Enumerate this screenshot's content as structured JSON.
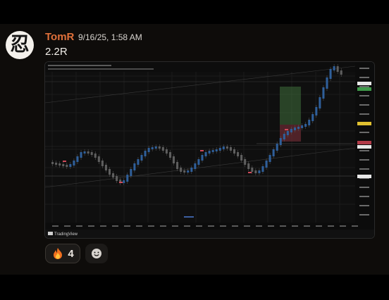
{
  "message": {
    "author": "TomR",
    "timestamp": "9/16/25, 1:58 AM",
    "text": "2.2R",
    "avatar_glyph": "忍",
    "author_color": "#e0703a"
  },
  "attachment": {
    "kind": "tradingview-chart-screenshot",
    "footer_brand": "TradingView",
    "colors": {
      "up_candle": "#2f5f9a",
      "down_candle": "#5e5e5e",
      "profit_zone": "#3f6f3c",
      "loss_zone": "#7a2e38",
      "background": "#0f0f0f"
    }
  },
  "reactions": [
    {
      "icon": "fire-icon",
      "emoji": "🔥",
      "count": "4"
    }
  ],
  "add_reaction": {
    "icon": "smiley-icon"
  }
}
